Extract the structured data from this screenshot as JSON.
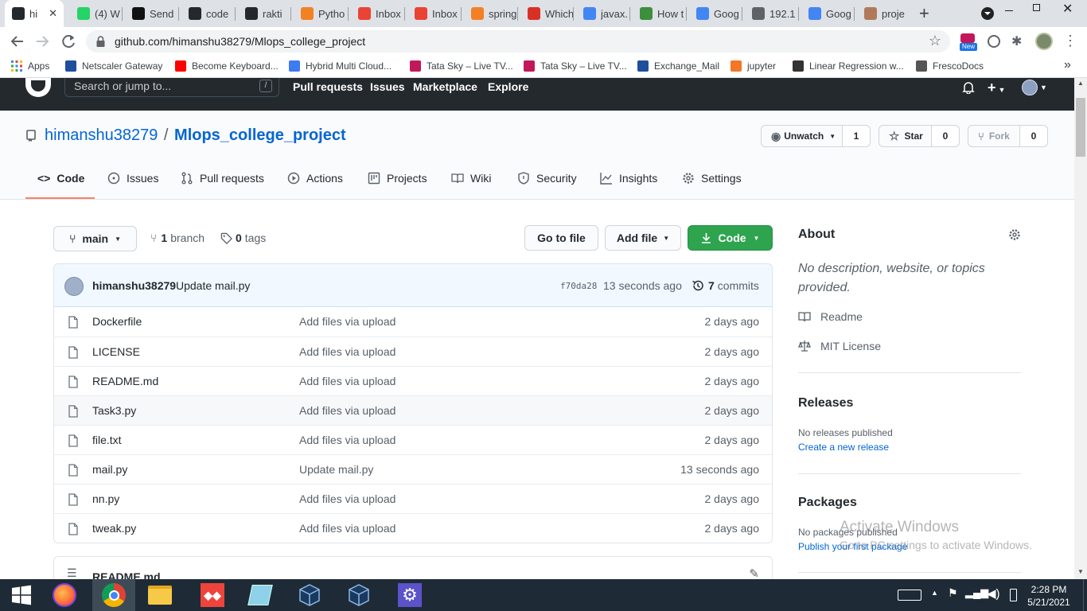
{
  "browser": {
    "tabs": [
      {
        "title": "hi",
        "color": "#24292e",
        "icon": "github-icon",
        "active": true
      },
      {
        "title": "(4) W",
        "color": "#25d366",
        "icon": "whatsapp-icon"
      },
      {
        "title": "Send",
        "color": "#111111",
        "icon": "sendinblue-icon"
      },
      {
        "title": "code",
        "color": "#24292e",
        "icon": "github-icon"
      },
      {
        "title": "rakti",
        "color": "#24292e",
        "icon": "github-icon"
      },
      {
        "title": "Pytho",
        "color": "#f48024",
        "icon": "stackoverflow-icon"
      },
      {
        "title": "Inbox",
        "color": "#ea4335",
        "icon": "gmail-icon"
      },
      {
        "title": "Inbox",
        "color": "#ea4335",
        "icon": "gmail-icon"
      },
      {
        "title": "spring",
        "color": "#f48024",
        "icon": "stackoverflow-icon"
      },
      {
        "title": "Which",
        "color": "#d93025",
        "icon": "target-icon"
      },
      {
        "title": "javax.",
        "color": "#4285f4",
        "icon": "google-icon"
      },
      {
        "title": "How t",
        "color": "#3c8f3c",
        "icon": "wikihow-icon"
      },
      {
        "title": "Goog",
        "color": "#4285f4",
        "icon": "google-icon"
      },
      {
        "title": "192.1",
        "color": "#5f6368",
        "icon": "globe-icon"
      },
      {
        "title": "Goog",
        "color": "#4285f4",
        "icon": "google-icon"
      },
      {
        "title": "proje",
        "color": "#b07a5a",
        "icon": "avatar-icon"
      }
    ],
    "new_tab": "+",
    "url": "github.com/himanshu38279/Mlops_college_project",
    "bookmarks": [
      {
        "label": "Apps",
        "color": "#4285f4"
      },
      {
        "label": "Netscaler Gateway",
        "color": "#1f4e9d"
      },
      {
        "label": "Become Keyboard...",
        "color": "#ff0000"
      },
      {
        "label": "Hybrid Multi Cloud...",
        "color": "#3d7bf0"
      },
      {
        "label": "Tata Sky – Live TV...",
        "color": "#c2185b"
      },
      {
        "label": "Tata Sky – Live TV...",
        "color": "#c2185b"
      },
      {
        "label": "Exchange_Mail",
        "color": "#1f4e9d"
      },
      {
        "label": "jupyter",
        "color": "#f37726"
      },
      {
        "label": "Linear Regression w...",
        "color": "#333333"
      },
      {
        "label": "FrescoDocs",
        "color": "#555555"
      }
    ],
    "more": "»",
    "new_badge": "New"
  },
  "gh": {
    "search_placeholder": "Search or jump to...",
    "slash": "/",
    "nav": [
      "Pull requests",
      "Issues",
      "Marketplace",
      "Explore"
    ]
  },
  "repo": {
    "owner": "himanshu38279",
    "sep": "/",
    "name": "Mlops_college_project",
    "unwatch": "Unwatch",
    "unwatch_count": "1",
    "star": "Star",
    "star_count": "0",
    "fork": "Fork",
    "fork_count": "0",
    "tabs": [
      "Code",
      "Issues",
      "Pull requests",
      "Actions",
      "Projects",
      "Wiki",
      "Security",
      "Insights",
      "Settings"
    ]
  },
  "main": {
    "branch": "main",
    "branch_count": "1",
    "branch_label": "branch",
    "tag_count": "0",
    "tag_label": "tags",
    "go_to_file": "Go to file",
    "add_file": "Add file",
    "code": "Code",
    "commit_author": "himanshu38279",
    "commit_msg": "Update mail.py",
    "commit_sha": "f70da28",
    "commit_time": "13 seconds ago",
    "commit_count": "7",
    "commit_label": "commits",
    "files": [
      {
        "name": "Dockerfile",
        "msg": "Add files via upload",
        "age": "2 days ago"
      },
      {
        "name": "LICENSE",
        "msg": "Add files via upload",
        "age": "2 days ago"
      },
      {
        "name": "README.md",
        "msg": "Add files via upload",
        "age": "2 days ago"
      },
      {
        "name": "Task3.py",
        "msg": "Add files via upload",
        "age": "2 days ago"
      },
      {
        "name": "file.txt",
        "msg": "Add files via upload",
        "age": "2 days ago"
      },
      {
        "name": "mail.py",
        "msg": "Update mail.py",
        "age": "13 seconds ago"
      },
      {
        "name": "nn.py",
        "msg": "Add files via upload",
        "age": "2 days ago"
      },
      {
        "name": "tweak.py",
        "msg": "Add files via upload",
        "age": "2 days ago"
      }
    ],
    "readme_label": "README.md"
  },
  "sidebar": {
    "about": "About",
    "desc_line1": "No description, website, or topics",
    "desc_line2": "provided.",
    "readme": "Readme",
    "license": "MIT License",
    "releases": "Releases",
    "no_releases": "No releases published",
    "create_release": "Create a new release",
    "packages": "Packages",
    "no_packages": "No packages published",
    "publish_package": "Publish your first package"
  },
  "watermark": {
    "line1": "Activate Windows",
    "line2": "Go to PC settings to activate Windows."
  },
  "taskbar": {
    "time": "2:28 PM",
    "date": "5/21/2021"
  },
  "colors": {
    "link": "#0366d6",
    "green": "#2ea44f",
    "accent_tab": "#f9826c",
    "header": "#24292e"
  }
}
